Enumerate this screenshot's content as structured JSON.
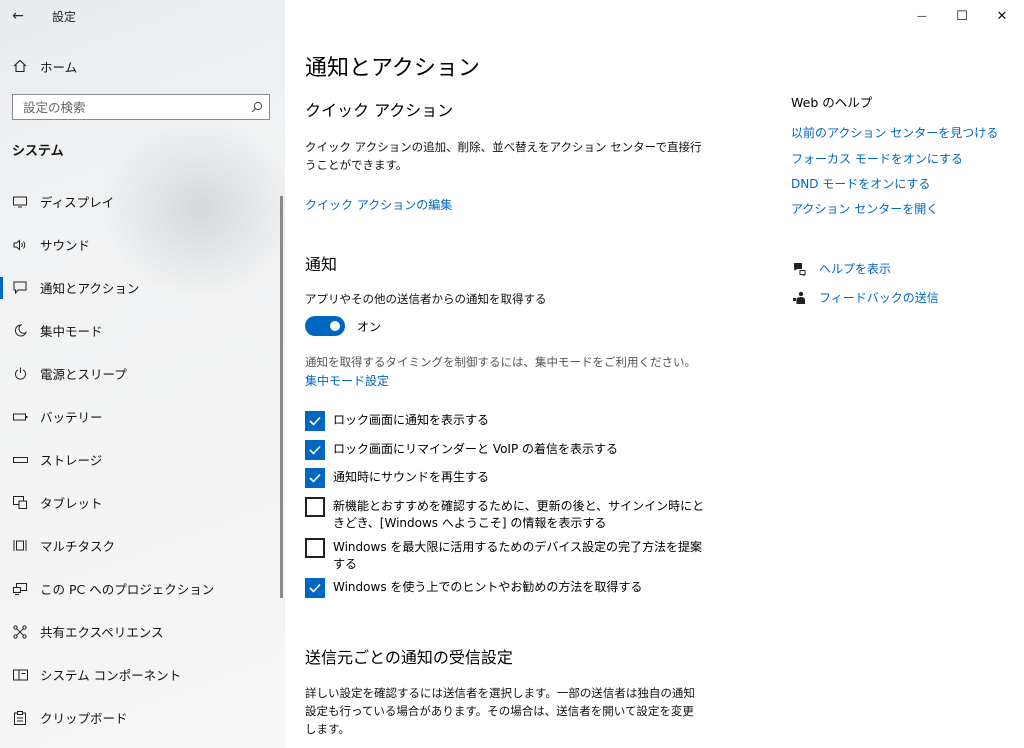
{
  "window": {
    "app_title": "設定",
    "back_glyph": "←",
    "minimize_glyph": "—",
    "maximize_glyph": "☐",
    "close_glyph": "✕"
  },
  "sidebar": {
    "home_label": "ホーム",
    "search_placeholder": "設定の検索",
    "section_label": "システム",
    "items": [
      {
        "label": "ディスプレイ",
        "icon": "display-icon"
      },
      {
        "label": "サウンド",
        "icon": "sound-icon"
      },
      {
        "label": "通知とアクション",
        "icon": "notifications-icon",
        "selected": true
      },
      {
        "label": "集中モード",
        "icon": "focus-assist-icon"
      },
      {
        "label": "電源とスリープ",
        "icon": "power-icon"
      },
      {
        "label": "バッテリー",
        "icon": "battery-icon"
      },
      {
        "label": "ストレージ",
        "icon": "storage-icon"
      },
      {
        "label": "タブレット",
        "icon": "tablet-icon"
      },
      {
        "label": "マルチタスク",
        "icon": "multitasking-icon"
      },
      {
        "label": "この PC へのプロジェクション",
        "icon": "projection-icon"
      },
      {
        "label": "共有エクスペリエンス",
        "icon": "shared-experiences-icon"
      },
      {
        "label": "システム コンポーネント",
        "icon": "system-components-icon"
      },
      {
        "label": "クリップボード",
        "icon": "clipboard-icon"
      }
    ]
  },
  "main": {
    "page_title": "通知とアクション",
    "quick_actions": {
      "heading": "クイック アクション",
      "description": "クイック アクションの追加、削除、並べ替えをアクション センターで直接行うことができます。",
      "edit_link": "クイック アクションの編集"
    },
    "notifications": {
      "heading": "通知",
      "toggle_caption": "アプリやその他の送信者からの通知を取得する",
      "toggle_state": "オン",
      "toggle_on": true,
      "focus_hint": "通知を取得するタイミングを制御するには、集中モードをご利用ください。",
      "focus_link": "集中モード設定",
      "checkboxes": [
        {
          "label": "ロック画面に通知を表示する",
          "checked": true
        },
        {
          "label": "ロック画面にリマインダーと VoIP の着信を表示する",
          "checked": true
        },
        {
          "label": "通知時にサウンドを再生する",
          "checked": true
        },
        {
          "label": "新機能とおすすめを確認するために、更新の後と、サインイン時にときどき、[Windows へようこそ] の情報を表示する",
          "checked": false
        },
        {
          "label": "Windows を最大限に活用するためのデバイス設定の完了方法を提案する",
          "checked": false
        },
        {
          "label": "Windows を使う上でのヒントやお勧めの方法を取得する",
          "checked": true
        }
      ]
    },
    "per_sender": {
      "heading": "送信元ごとの通知の受信設定",
      "description": "詳しい設定を確認するには送信者を選択します。一部の送信者は独自の通知設定も行っている場合があります。その場合は、送信者を開いて設定を変更します。"
    }
  },
  "rail": {
    "title": "Web のヘルプ",
    "links": [
      "以前のアクション センターを見つける",
      "フォーカス モードをオンにする",
      "DND モードをオンにする",
      "アクション センターを開く"
    ],
    "get_help": "ヘルプを表示",
    "feedback": "フィードバックの送信"
  },
  "colors": {
    "accent": "#0067c0",
    "sidebar_bg": "#f2f2f2"
  }
}
